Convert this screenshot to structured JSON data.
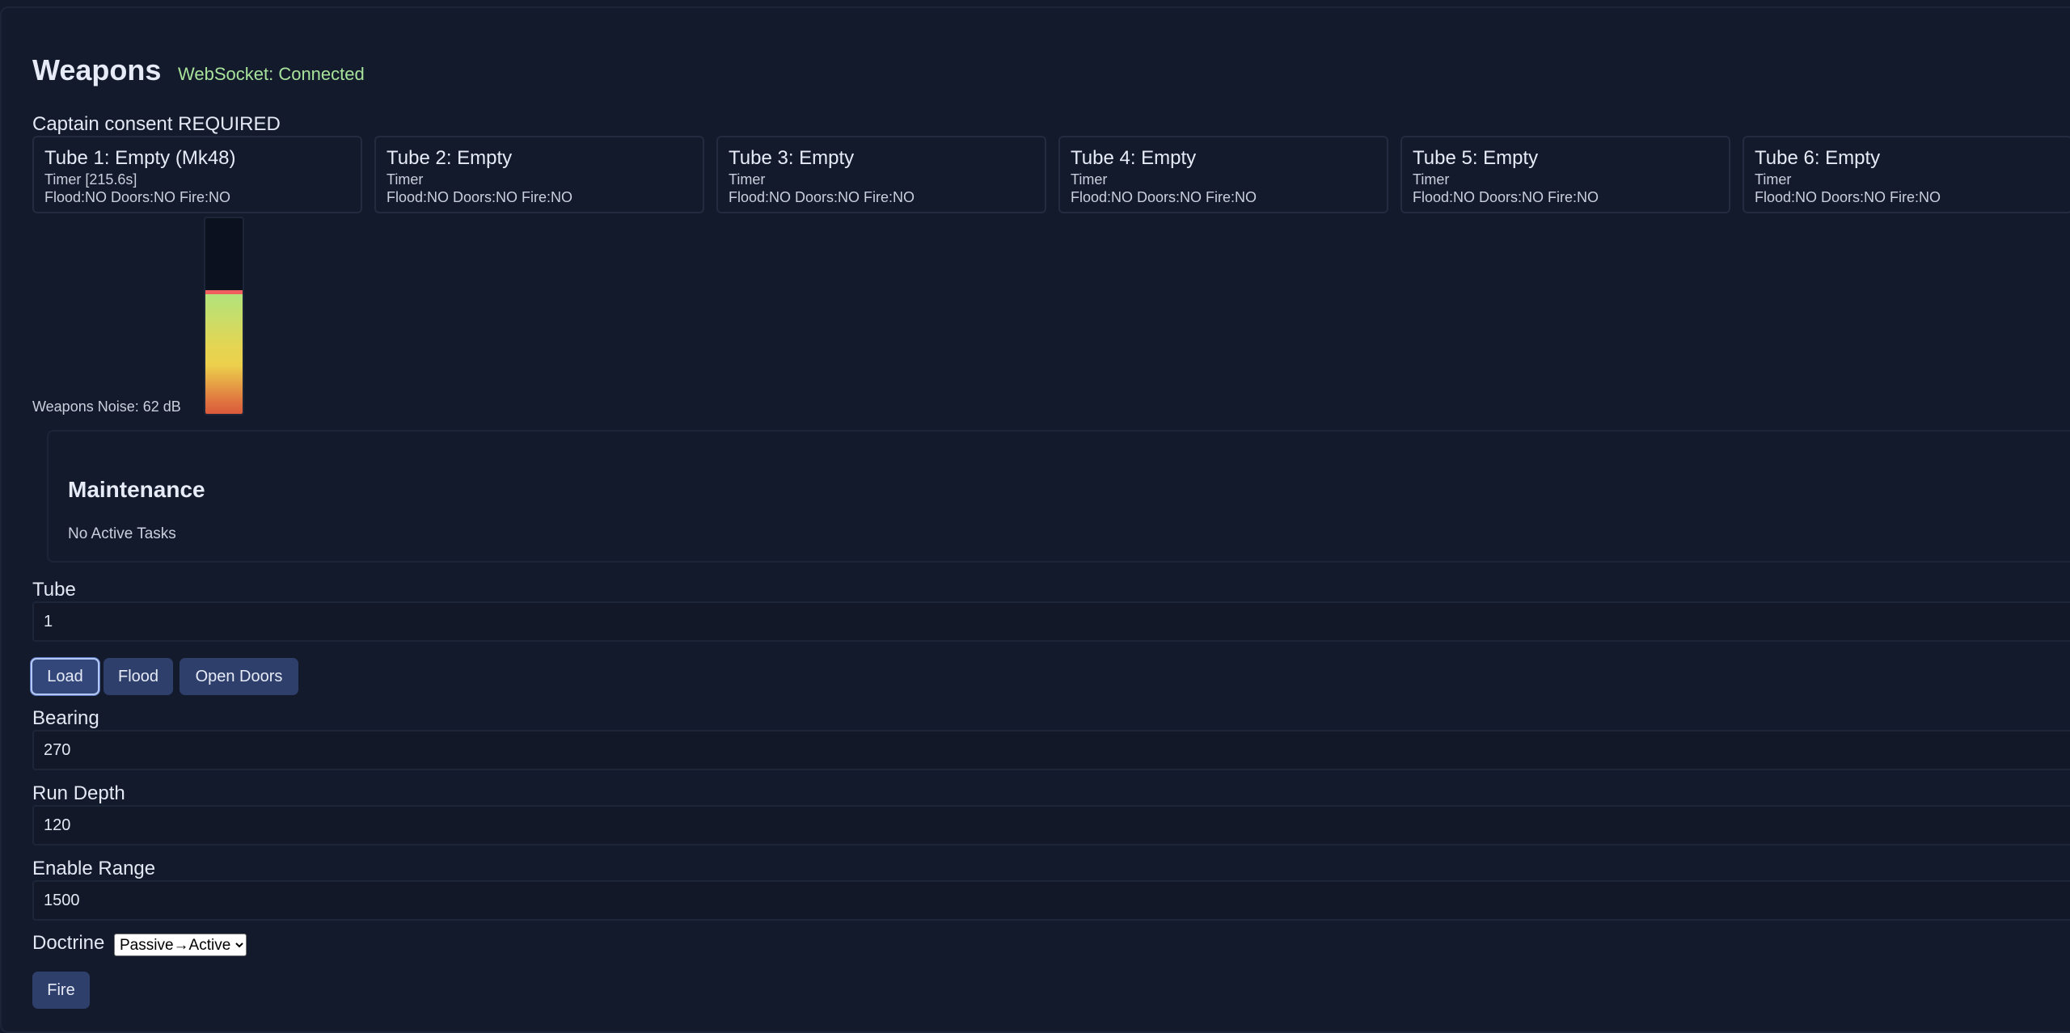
{
  "header": {
    "title": "Weapons",
    "websocket_status": "WebSocket: Connected"
  },
  "consent": "Captain consent REQUIRED",
  "tubes": [
    {
      "title": "Tube 1: Empty (Mk48)",
      "timer": "Timer [215.6s]",
      "status": "Flood:NO Doors:NO Fire:NO"
    },
    {
      "title": "Tube 2: Empty",
      "timer": "Timer",
      "status": "Flood:NO Doors:NO Fire:NO"
    },
    {
      "title": "Tube 3: Empty",
      "timer": "Timer",
      "status": "Flood:NO Doors:NO Fire:NO"
    },
    {
      "title": "Tube 4: Empty",
      "timer": "Timer",
      "status": "Flood:NO Doors:NO Fire:NO"
    },
    {
      "title": "Tube 5: Empty",
      "timer": "Timer",
      "status": "Flood:NO Doors:NO Fire:NO"
    },
    {
      "title": "Tube 6: Empty",
      "timer": "Timer",
      "status": "Flood:NO Doors:NO Fire:NO"
    }
  ],
  "noise": {
    "label": "Weapons Noise: 62 dB",
    "level_fraction": 0.62
  },
  "maintenance": {
    "title": "Maintenance",
    "text": "No Active Tasks"
  },
  "controls": {
    "tube_label": "Tube",
    "tube_value": "1",
    "load_label": "Load",
    "flood_label": "Flood",
    "open_doors_label": "Open Doors",
    "bearing_label": "Bearing",
    "bearing_value": "270",
    "run_depth_label": "Run Depth",
    "run_depth_value": "120",
    "enable_range_label": "Enable Range",
    "enable_range_value": "1500",
    "doctrine_label": "Doctrine",
    "doctrine_value": "Passive→Active",
    "fire_label": "Fire"
  },
  "colors": {
    "background": "#131a2b",
    "button": "#2f3f6b",
    "connected": "#a8e39b",
    "meter_peak": "#ee5f5d"
  }
}
